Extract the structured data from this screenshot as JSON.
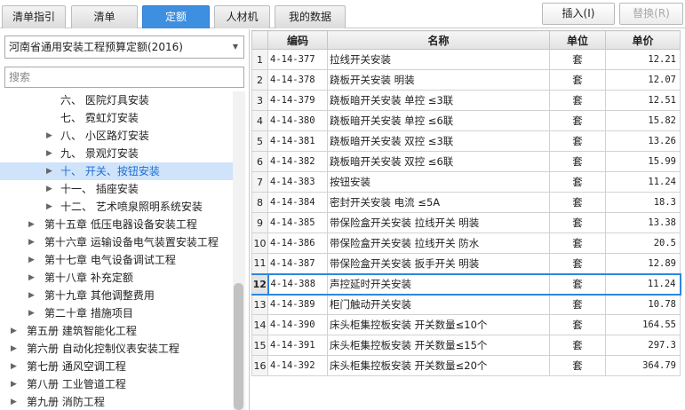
{
  "tabs": [
    {
      "label": "清单指引",
      "active": false
    },
    {
      "label": "清单",
      "active": false
    },
    {
      "label": "定额",
      "active": true
    },
    {
      "label": "人材机",
      "active": false
    },
    {
      "label": "我的数据",
      "active": false
    }
  ],
  "toolbar": {
    "insert_label": "插入(I)",
    "replace_label": "替换(R)"
  },
  "quota_selector": {
    "value": "河南省通用安装工程预算定额(2016)"
  },
  "search": {
    "placeholder": "搜索"
  },
  "tree": [
    {
      "label": "六、 医院灯具安装",
      "expander": false
    },
    {
      "label": "七、 霓虹灯安装",
      "expander": false
    },
    {
      "label": "八、 小区路灯安装",
      "expander": true
    },
    {
      "label": "九、 景观灯安装",
      "expander": true
    },
    {
      "label": "十、 开关、按钮安装",
      "expander": true,
      "selected": true
    },
    {
      "label": "十一、 插座安装",
      "expander": true
    },
    {
      "label": "十二、 艺术喷泉照明系统安装",
      "expander": true
    },
    {
      "label": "第十五章 低压电器设备安装工程",
      "expander": true
    },
    {
      "label": "第十六章 运输设备电气装置安装工程",
      "expander": true
    },
    {
      "label": "第十七章 电气设备调试工程",
      "expander": true
    },
    {
      "label": "第十八章 补充定额",
      "expander": true
    },
    {
      "label": "第十九章 其他调整费用",
      "expander": true
    },
    {
      "label": "第二十章 措施项目",
      "expander": true
    },
    {
      "label": "第五册 建筑智能化工程",
      "expander": true
    },
    {
      "label": "第六册 自动化控制仪表安装工程",
      "expander": true
    },
    {
      "label": "第七册 通风空调工程",
      "expander": true
    },
    {
      "label": "第八册 工业管道工程",
      "expander": true
    },
    {
      "label": "第九册 消防工程",
      "expander": true
    }
  ],
  "grid": {
    "headers": {
      "code": "编码",
      "name": "名称",
      "unit": "单位",
      "price": "单价"
    },
    "rows": [
      {
        "idx": "1",
        "code": "4-14-377",
        "name": "拉线开关安装",
        "unit": "套",
        "price": "12.21"
      },
      {
        "idx": "2",
        "code": "4-14-378",
        "name": "跷板开关安装 明装",
        "unit": "套",
        "price": "12.07"
      },
      {
        "idx": "3",
        "code": "4-14-379",
        "name": "跷板暗开关安装 单控 ≤3联",
        "unit": "套",
        "price": "12.51"
      },
      {
        "idx": "4",
        "code": "4-14-380",
        "name": "跷板暗开关安装 单控 ≤6联",
        "unit": "套",
        "price": "15.82"
      },
      {
        "idx": "5",
        "code": "4-14-381",
        "name": "跷板暗开关安装 双控 ≤3联",
        "unit": "套",
        "price": "13.26"
      },
      {
        "idx": "6",
        "code": "4-14-382",
        "name": "跷板暗开关安装 双控 ≤6联",
        "unit": "套",
        "price": "15.99"
      },
      {
        "idx": "7",
        "code": "4-14-383",
        "name": "按钮安装",
        "unit": "套",
        "price": "11.24"
      },
      {
        "idx": "8",
        "code": "4-14-384",
        "name": "密封开关安装 电流 ≤5A",
        "unit": "套",
        "price": "18.3"
      },
      {
        "idx": "9",
        "code": "4-14-385",
        "name": "带保险盒开关安装 拉线开关 明装",
        "unit": "套",
        "price": "13.38"
      },
      {
        "idx": "10",
        "code": "4-14-386",
        "name": "带保险盒开关安装 拉线开关 防水",
        "unit": "套",
        "price": "20.5"
      },
      {
        "idx": "11",
        "code": "4-14-387",
        "name": "带保险盒开关安装 扳手开关 明装",
        "unit": "套",
        "price": "12.89"
      },
      {
        "idx": "12",
        "code": "4-14-388",
        "name": "声控延时开关安装",
        "unit": "套",
        "price": "11.24",
        "selected": true
      },
      {
        "idx": "13",
        "code": "4-14-389",
        "name": "柜门触动开关安装",
        "unit": "套",
        "price": "10.78"
      },
      {
        "idx": "14",
        "code": "4-14-390",
        "name": "床头柜集控板安装 开关数量≤10个",
        "unit": "套",
        "price": "164.55"
      },
      {
        "idx": "15",
        "code": "4-14-391",
        "name": "床头柜集控板安装 开关数量≤15个",
        "unit": "套",
        "price": "297.3"
      },
      {
        "idx": "16",
        "code": "4-14-392",
        "name": "床头柜集控板安装 开关数量≤20个",
        "unit": "套",
        "price": "364.79"
      }
    ]
  }
}
